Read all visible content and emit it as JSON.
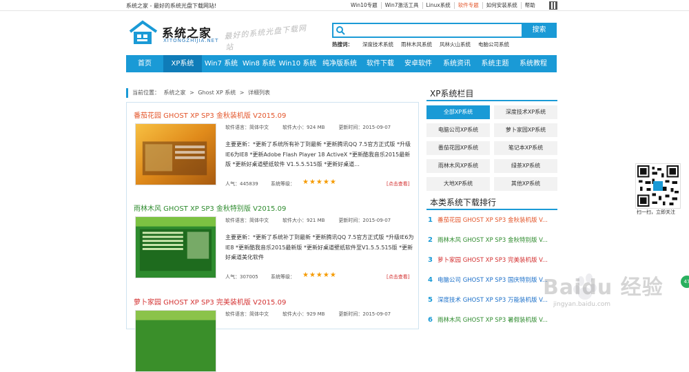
{
  "topbar": {
    "slogan": "系统之家 - 最好的系统光盘下载网站!",
    "links": [
      "Win10专题",
      "Win7激活工具",
      "Linux系统",
      "软件专题",
      "如何安装系统",
      "帮助"
    ]
  },
  "logo": {
    "name": "系统之家",
    "url": "XITONGZHIJIA.NET",
    "slogan": "最好的系统光盘下载网站"
  },
  "search": {
    "placeholder": "",
    "button": "搜索"
  },
  "hotwords": {
    "label": "热搜词：",
    "items": [
      "深度技术系统",
      "雨林木风系统",
      "风林火山系统",
      "电脑公司系统"
    ]
  },
  "nav": [
    "首页",
    "XP系统",
    "Win7 系统",
    "Win8 系统",
    "Win10 系统",
    "纯净版系统",
    "软件下载",
    "安卓软件",
    "系统资讯",
    "系统主题",
    "系统教程"
  ],
  "breadcrumb": {
    "prefix": "当前位置：",
    "items": [
      "系统之家",
      ">",
      "Ghost XP 系统",
      ">",
      "详细列表"
    ]
  },
  "items": [
    {
      "title": "番茄花园 GHOST XP SP3 金秋装机版 V2015.09",
      "title_color": "#e3552a",
      "lang": "软件语言：简体中文",
      "size": "软件大小：924 MB",
      "date": "更新时间：2015-09-07",
      "desc": "主要更新：*更新了系统所有补丁到最新 *更新腾讯QQ 7.5官方正式版 *升级IE6为IE8 *更新Adobe Flash Player 18 ActiveX *更新酷我音乐2015最新版 *更新好桌道壁纸软件 V1.5.5.515版 *更新好桌道...",
      "pop": "人气：445839",
      "rank": "系统等级：",
      "stars": "★★★★★",
      "more": "[点击查看]"
    },
    {
      "title": "雨林木风 GHOST XP SP3 金秋特别版 V2015.09",
      "title_color": "#2e8b2e",
      "lang": "软件语言：简体中文",
      "size": "软件大小：921 MB",
      "date": "更新时间：2015-09-07",
      "desc": "主要更新：*更新了系统补丁到最新 *更新腾讯QQ 7.5官方正式版 *升级IE6为IE8 *更新酷我音乐2015最新版 *更新好桌道壁纸软件至V1.5.5.515版 *更新好桌道美化软件",
      "pop": "人气：307005",
      "rank": "系统等级：",
      "stars": "★★★★★",
      "more": "[点击查看]"
    },
    {
      "title": "萝卜家园 GHOST XP SP3 完美装机版 V2015.09",
      "title_color": "#d32f2f",
      "lang": "软件语言：简体中文",
      "size": "软件大小：929 MB",
      "date": "更新时间：2015-09-07",
      "desc": "",
      "pop": "",
      "rank": "",
      "stars": "",
      "more": ""
    }
  ],
  "sidebar": {
    "title": "XP系统栏目",
    "cats": [
      "全部XP系统",
      "深度技术XP系统",
      "电脑公司XP系统",
      "萝卜家园XP系统",
      "番茄花园XP系统",
      "笔记本XP系统",
      "雨林木风XP系统",
      "绿茶XP系统",
      "大地XP系统",
      "其他XP系统"
    ],
    "rank_title": "本类系统下载排行",
    "rank": [
      {
        "n": "1",
        "text": "番茄花园 GHOST XP SP3 金秋装机版 V...",
        "color": "#e3552a"
      },
      {
        "n": "2",
        "text": "雨林木风 GHOST XP SP3 金秋特别版 V...",
        "color": "#2e8b2e"
      },
      {
        "n": "3",
        "text": "萝卜家园 GHOST XP SP3 完美装机版 V...",
        "color": "#d32f2f"
      },
      {
        "n": "4",
        "text": "电脑公司 GHOST XP SP3 国庆特别版 V...",
        "color": "#1a6fc9"
      },
      {
        "n": "5",
        "text": "深度技术 GHOST XP SP3 万能装机版 V...",
        "color": "#1a6fc9"
      },
      {
        "n": "6",
        "text": "雨林木风 GHOST XP SP3 暑假装机版 V...",
        "color": "#2e8b2e"
      }
    ]
  },
  "qr_label": "扫一扫，立即关注",
  "watermark": {
    "text": "Baidu 经验",
    "url": "jingyan.baidu.com"
  },
  "float_btn": "47"
}
